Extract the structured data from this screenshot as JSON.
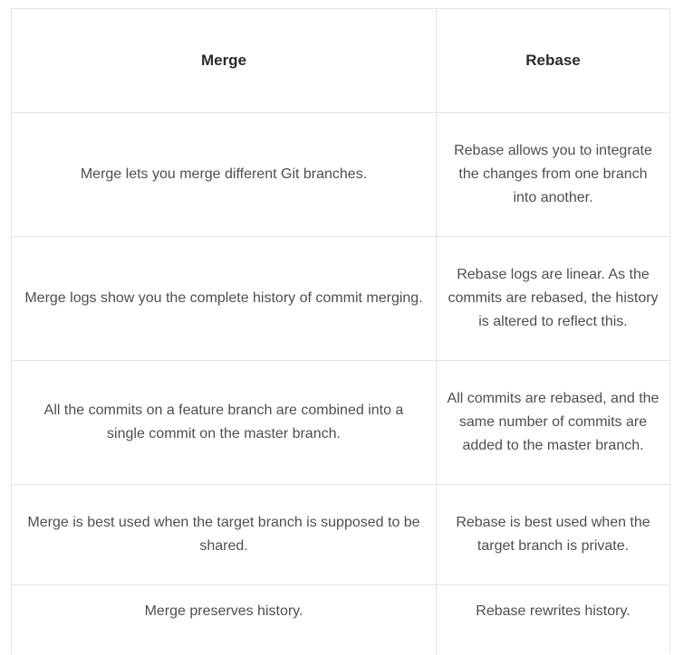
{
  "table": {
    "headers": [
      "Merge",
      "Rebase"
    ],
    "rows": [
      [
        "Merge lets you merge different Git branches.",
        "Rebase allows you to integrate the changes from one branch into another."
      ],
      [
        "Merge logs show you the complete history of commit merging.",
        "Rebase logs are linear. As the commits are rebased, the history is altered to reflect this."
      ],
      [
        "All the commits on a feature branch are combined into a single commit on the master branch.",
        "All commits are rebased, and the same number of commits are added to the master branch."
      ],
      [
        "Merge is best used when the target branch is supposed to be shared.",
        "Rebase is best used when the target branch is private."
      ],
      [
        "Merge preserves history.",
        "Rebase rewrites history."
      ]
    ]
  }
}
